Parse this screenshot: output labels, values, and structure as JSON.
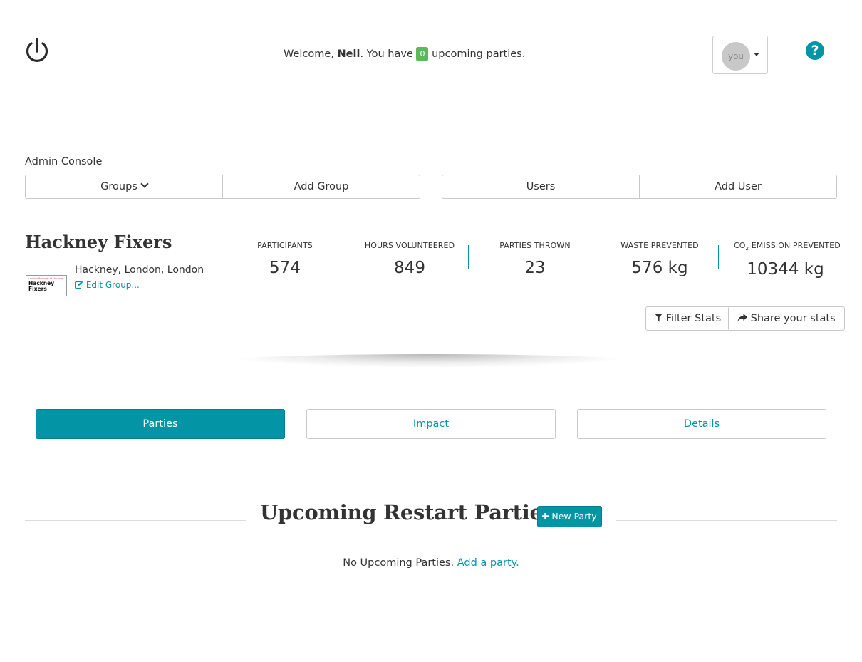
{
  "header": {
    "logo_icon": "power-icon",
    "welcome_prefix": "Welcome, ",
    "user_name": "Neil",
    "welcome_middle": ". You have ",
    "upcoming_count": "0",
    "welcome_suffix": " upcoming parties.",
    "avatar_text": "you",
    "help_icon": "question-mark-icon",
    "help_text": "?",
    "accent_color": "#0394a6",
    "badge_color": "#5cb85c"
  },
  "admin": {
    "title": "Admin Console",
    "groups_label": "Groups",
    "add_group_label": "Add Group",
    "users_label": "Users",
    "add_user_label": "Add User"
  },
  "group": {
    "name": "Hackney Fixers",
    "logo_small_text": "London Borough of Hackney",
    "logo_text_line1": "Hackney",
    "logo_text_line2": "Fixers",
    "location": "Hackney, London, London",
    "edit_label": "Edit Group..."
  },
  "stats": [
    {
      "label": "PARTICIPANTS",
      "value": "574"
    },
    {
      "label": "HOURS VOLUNTEERED",
      "value": "849"
    },
    {
      "label": "PARTIES THROWN",
      "value": "23"
    },
    {
      "label": "WASTE PREVENTED",
      "value": "576 kg"
    },
    {
      "label_prefix": "CO",
      "label_sub": "2",
      "label_suffix": " EMISSION PREVENTED",
      "value": "10344 kg"
    }
  ],
  "stat_actions": {
    "filter_label": "Filter Stats",
    "share_label": "Share your stats"
  },
  "tabs": [
    {
      "label": "Parties",
      "active": true
    },
    {
      "label": "Impact",
      "active": false
    },
    {
      "label": "Details",
      "active": false
    }
  ],
  "upcoming": {
    "title": "Upcoming Restart Parties",
    "new_party_label": "New Party",
    "empty_text": "No Upcoming Parties. ",
    "add_link_label": "Add a party."
  }
}
